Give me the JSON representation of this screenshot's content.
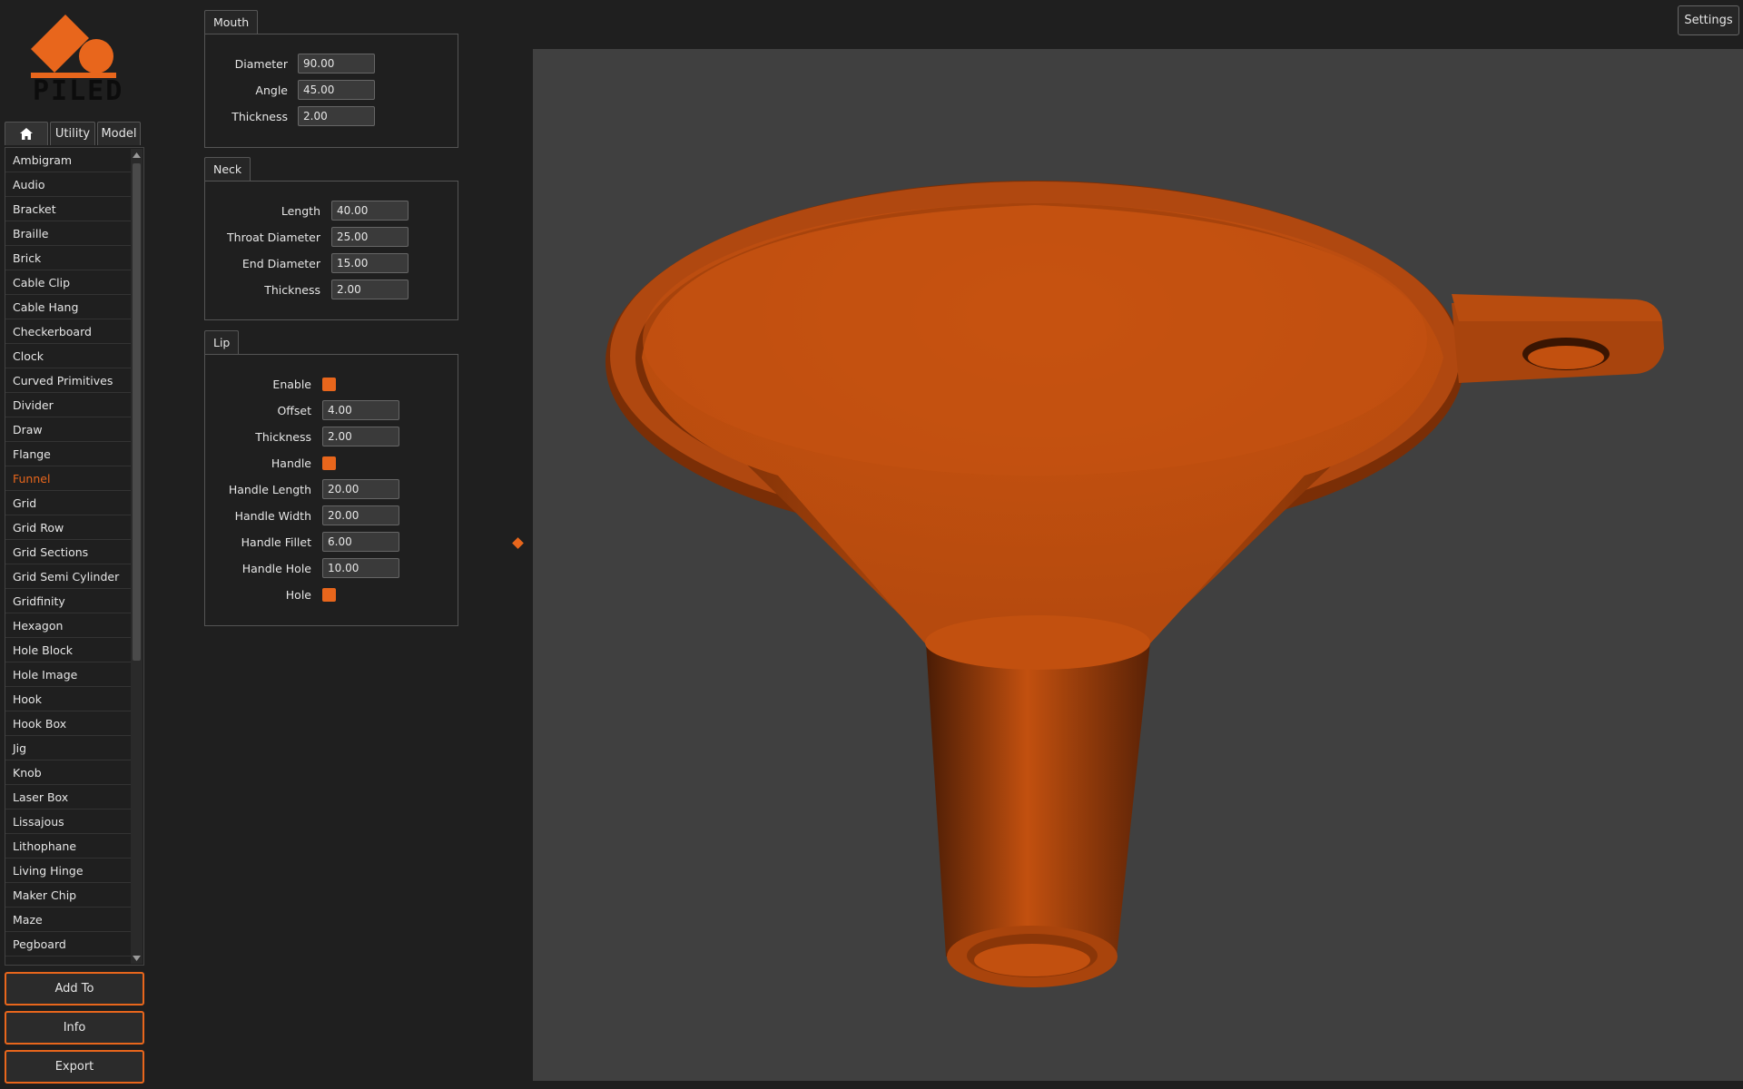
{
  "app": {
    "logo_text": "PILED",
    "settings_label": "Settings"
  },
  "tabs": {
    "home_icon": "home-icon",
    "utility": "Utility",
    "model": "Model"
  },
  "model_list": {
    "items": [
      "Ambigram",
      "Audio",
      "Bracket",
      "Braille",
      "Brick",
      "Cable Clip",
      "Cable Hang",
      "Checkerboard",
      "Clock",
      "Curved Primitives",
      "Divider",
      "Draw",
      "Flange",
      "Funnel",
      "Grid",
      "Grid Row",
      "Grid Sections",
      "Grid Semi Cylinder",
      "Gridfinity",
      "Hexagon",
      "Hole Block",
      "Hole Image",
      "Hook",
      "Hook Box",
      "Jig",
      "Knob",
      "Laser Box",
      "Lissajous",
      "Lithophane",
      "Living Hinge",
      "Maker Chip",
      "Maze",
      "Pegboard"
    ],
    "selected": "Funnel"
  },
  "actions": {
    "add_to": "Add To",
    "info": "Info",
    "export": "Export"
  },
  "mouth": {
    "title": "Mouth",
    "diameter_label": "Diameter",
    "diameter": "90.00",
    "angle_label": "Angle",
    "angle": "45.00",
    "thickness_label": "Thickness",
    "thickness": "2.00"
  },
  "neck": {
    "title": "Neck",
    "length_label": "Length",
    "length": "40.00",
    "throat_label": "Throat Diameter",
    "throat_diameter": "25.00",
    "end_label": "End Diameter",
    "end_diameter": "15.00",
    "thickness_label": "Thickness",
    "thickness": "2.00"
  },
  "lip": {
    "title": "Lip",
    "enable_label": "Enable",
    "enable": true,
    "offset_label": "Offset",
    "offset": "4.00",
    "thickness_label": "Thickness",
    "thickness": "2.00",
    "handle_label": "Handle",
    "handle": true,
    "handle_length_label": "Handle Length",
    "handle_length": "20.00",
    "handle_width_label": "Handle Width",
    "handle_width": "20.00",
    "handle_fillet_label": "Handle Fillet",
    "handle_fillet": "6.00",
    "handle_hole_label": "Handle Hole",
    "handle_hole": "10.00",
    "hole_label": "Hole",
    "hole": true
  },
  "colors": {
    "accent": "#e8661c",
    "model": "#c2500f",
    "viewport_bg": "#404040"
  }
}
